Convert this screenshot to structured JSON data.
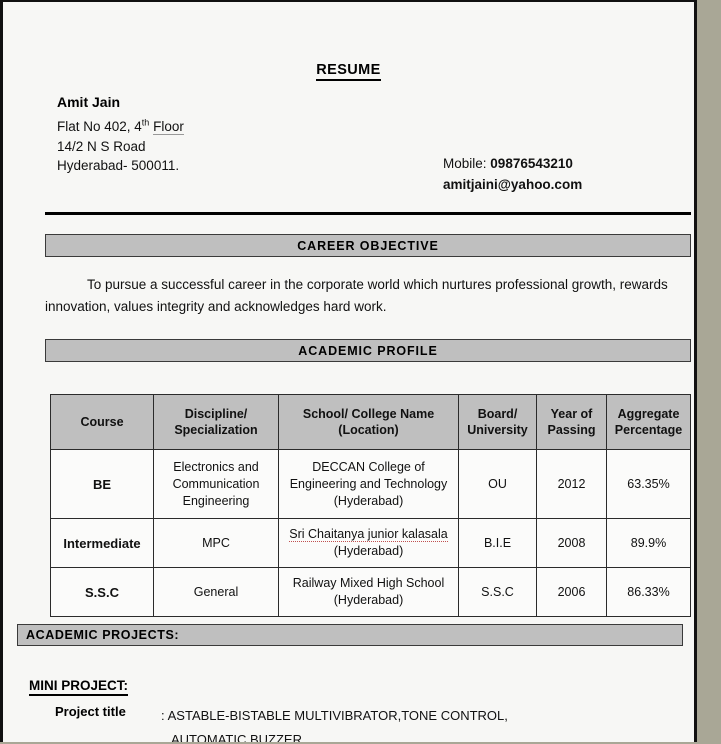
{
  "document": {
    "title": "RESUME"
  },
  "personal": {
    "name": "Amit Jain",
    "address_line1_pre": "Flat No 402, 4",
    "address_line1_sup": "th",
    "address_line1_post": "Floor",
    "address_line2": "14/2 N S Road",
    "address_line3": "Hyderabad- 500011."
  },
  "contact": {
    "mobile_label": "Mobile:",
    "mobile_value": "09876543210",
    "email": "amitjaini@yahoo.com"
  },
  "sections": {
    "career_objective_heading": "CAREER OBJECTIVE",
    "career_objective_text": "To pursue a successful career in the corporate world which nurtures professional growth, rewards innovation, values integrity and acknowledges hard work.",
    "academic_profile_heading": "ACADEMIC PROFILE",
    "academic_projects_heading": "ACADEMIC PROJECTS:"
  },
  "academic_table": {
    "headers": [
      "Course",
      "Discipline/ Specialization",
      "School/ College Name (Location)",
      "Board/ University",
      "Year of Passing",
      "Aggregate Percentage"
    ],
    "headers_split": [
      {
        "l1": "Course",
        "l2": ""
      },
      {
        "l1": "Discipline/",
        "l2": "Specialization"
      },
      {
        "l1": "School/ College Name",
        "l2": "(Location)"
      },
      {
        "l1": "Board/",
        "l2": "University"
      },
      {
        "l1": "Year of",
        "l2": "Passing"
      },
      {
        "l1": "Aggregate",
        "l2": "Percentage"
      }
    ],
    "rows": [
      {
        "course": "BE",
        "discipline_l1": "Electronics and",
        "discipline_l2": "Communication",
        "discipline_l3": "Engineering",
        "school_l1": "DECCAN College of",
        "school_l2": "Engineering and Technology",
        "school_l3": "(Hyderabad)",
        "board": "OU",
        "year": "2012",
        "percentage": "63.35%"
      },
      {
        "course": "Intermediate",
        "discipline_l1": "MPC",
        "discipline_l2": "",
        "discipline_l3": "",
        "school_l1": "Sri Chaitanya junior kalasala",
        "school_l2": "(Hyderabad)",
        "school_l3": "",
        "board": "B.I.E",
        "year": "2008",
        "percentage": "89.9%"
      },
      {
        "course": "S.S.C",
        "discipline_l1": "General",
        "discipline_l2": "",
        "discipline_l3": "",
        "school_l1": "Railway Mixed High School",
        "school_l2": "(Hyderabad)",
        "school_l3": "",
        "board": "S.S.C",
        "year": "2006",
        "percentage": "86.33%"
      }
    ]
  },
  "projects": {
    "mini_project_heading": "MINI PROJECT:",
    "project_title_label": "Project title",
    "project_title_colon": ":",
    "project_title_line1": "ASTABLE-BISTABLE MULTIVIBRATOR,TONE CONTROL,",
    "project_title_line2": "AUTOMATIC BUZZER"
  },
  "colors": {
    "page_background": "#f7f7f5",
    "outside_background": "#a9a796",
    "section_bar_gray": "#bfbfbf",
    "table_header_gray": "#bfbfbf",
    "border_dark": "#2b2b2b",
    "text": "#111111"
  }
}
